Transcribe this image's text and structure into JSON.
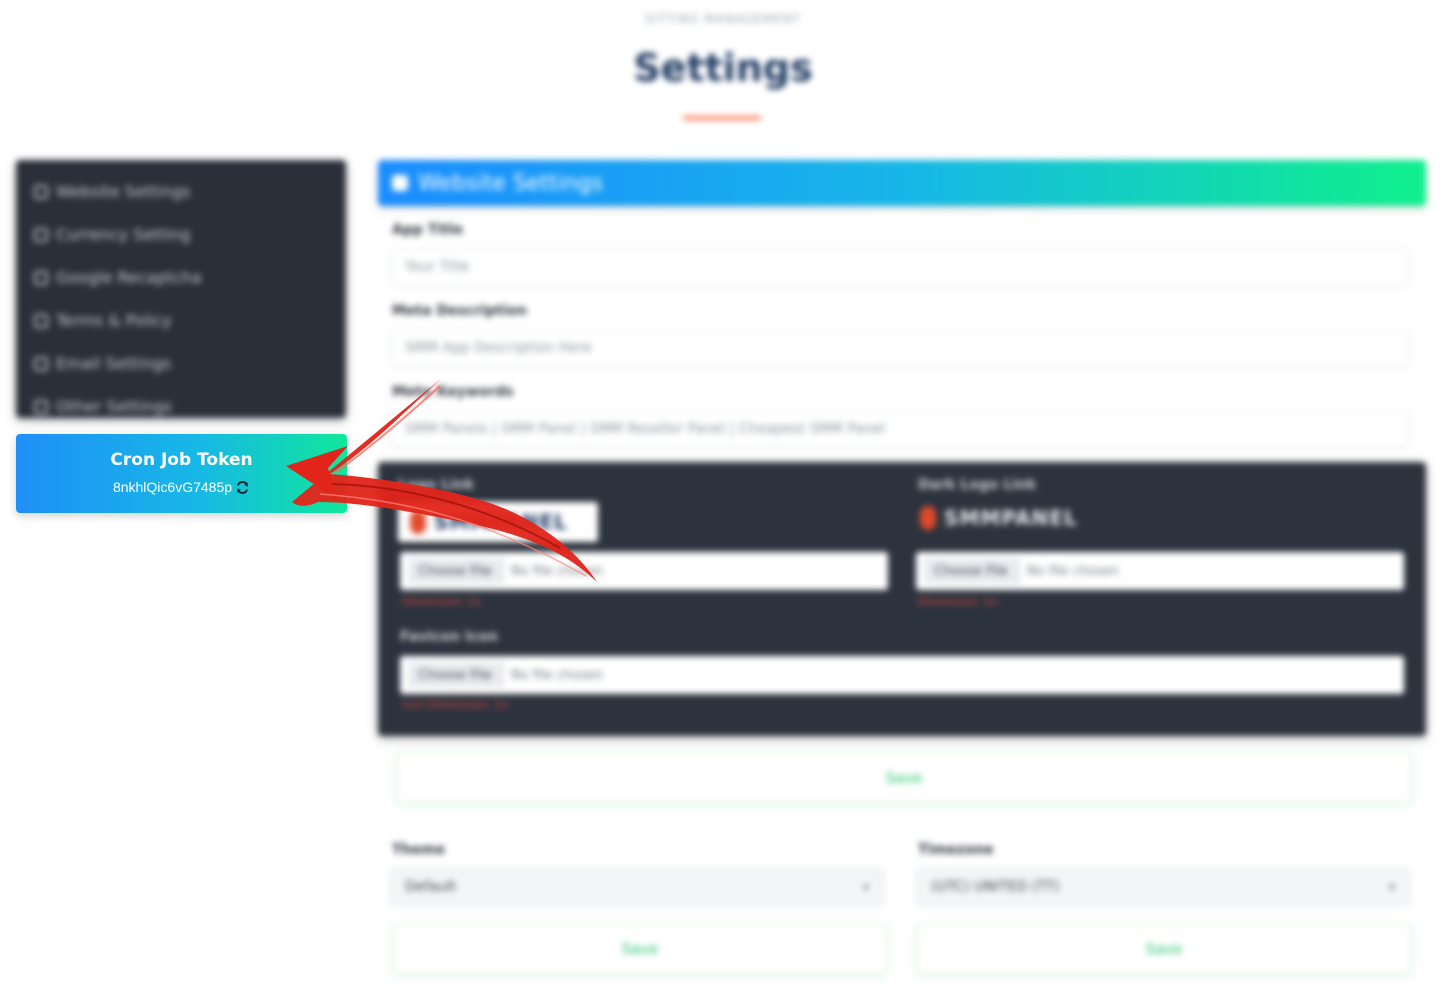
{
  "header": {
    "crumb": "SITTING MANAGEMENT",
    "title": "Settings"
  },
  "sidebar": {
    "items": [
      {
        "label": "Website Settings",
        "icon": "gear-icon"
      },
      {
        "label": "Currency Setting",
        "icon": "currency-icon"
      },
      {
        "label": "Google Recaptcha",
        "icon": "google-icon"
      },
      {
        "label": "Terms & Policy",
        "icon": "document-icon"
      },
      {
        "label": "Email Settings",
        "icon": "mail-icon"
      },
      {
        "label": "Other Settings",
        "icon": "sliders-icon"
      }
    ]
  },
  "cron": {
    "title": "Cron Job Token",
    "token": "8nkhlQic6vG7485p"
  },
  "panel": {
    "title": "Website Settings",
    "app_title_label": "App Title",
    "app_title_value": "Your Title",
    "meta_description_label": "Meta Description",
    "meta_description_value": "SMM App Description Here",
    "meta_keywords_label": "Meta Keywords",
    "meta_keywords_value": "SMM Panels | SMM Panel | SMM Reseller Panel | Cheapest SMM Panel",
    "logo_label": "Logo Link",
    "dark_logo_label": "Dark Logo Link",
    "logo_text": "SMMPANEL",
    "choose_file": "Choose File",
    "no_file": "No file chosen",
    "logo_hint": "Dimension: 1x",
    "favicon_label": "Favicon Icon",
    "favicon_hint": "Icon Dimension: 1x",
    "save": "Save"
  },
  "theme": {
    "label": "Theme",
    "value": "Default"
  },
  "timezone": {
    "label": "Timezone",
    "value": "(UTC) UNITED (TT)"
  }
}
